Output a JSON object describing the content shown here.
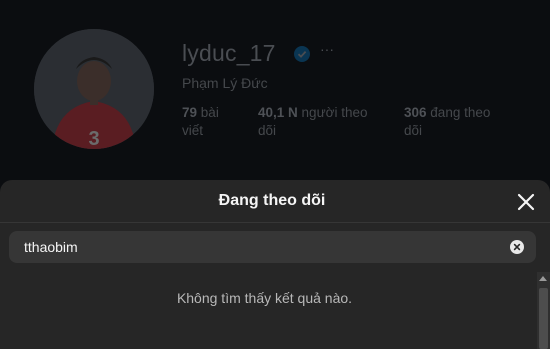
{
  "profile": {
    "username": "lyduc_17",
    "full_name": "Phạm Lý Đức",
    "more_icon": "more-dots-icon",
    "verified_icon": "verified-badge-icon",
    "stats": {
      "posts_value": "79",
      "posts_label": "bài viết",
      "followers_value": "40,1 N",
      "followers_label": "người theo dõi",
      "following_value": "306",
      "following_label": "đang theo dõi"
    }
  },
  "modal": {
    "title": "Đang theo dõi",
    "close_icon": "close-icon",
    "search": {
      "value": "tthaobim",
      "clear_icon": "clear-search-icon"
    },
    "empty_message": "Không tìm thấy kết quả nào."
  },
  "colors": {
    "page_background": "#0b0d10",
    "modal_background": "#262626",
    "search_background": "#363636",
    "verified_blue": "#0095f6"
  }
}
